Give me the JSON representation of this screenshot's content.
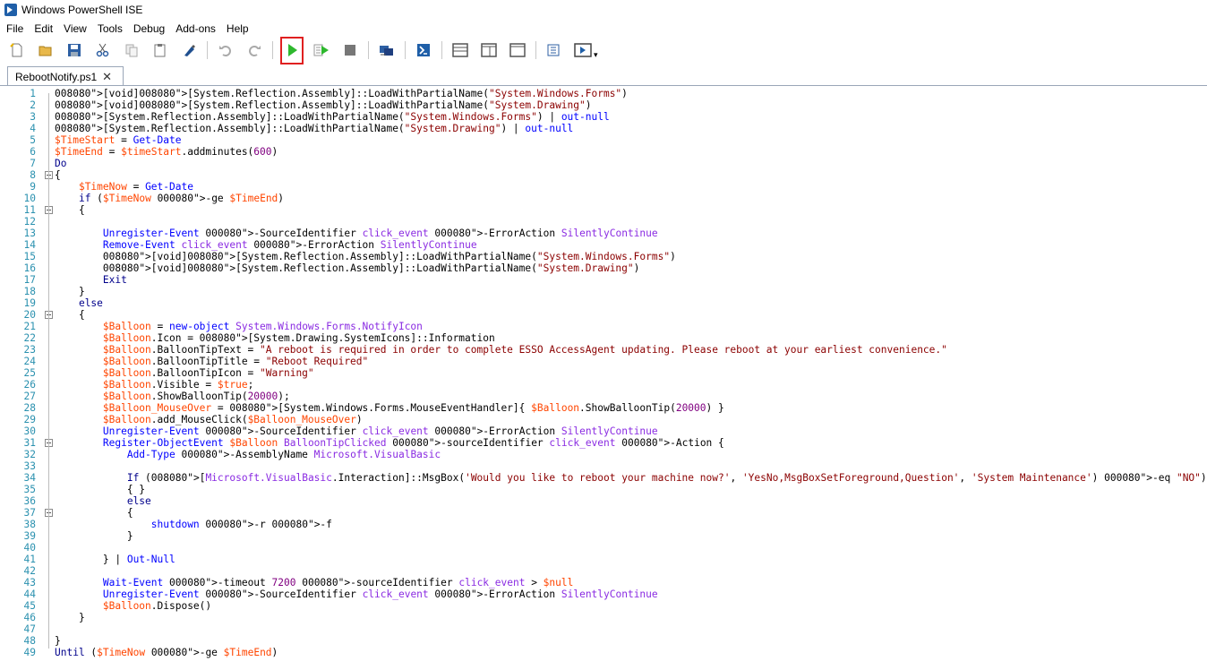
{
  "window": {
    "title": "Windows PowerShell ISE"
  },
  "menu": [
    "File",
    "Edit",
    "View",
    "Tools",
    "Debug",
    "Add-ons",
    "Help"
  ],
  "toolbar": {
    "icons": [
      "new-file-icon",
      "open-folder-icon",
      "save-icon",
      "cut-icon",
      "copy-icon",
      "paste-icon",
      "clear-console-icon",
      "undo-icon",
      "redo-icon",
      "run-script-icon",
      "run-selection-icon",
      "stop-icon",
      "remote-powershell-icon",
      "powershell-console-icon",
      "layout-top-icon",
      "layout-right-icon",
      "layout-max-icon",
      "show-commands-icon",
      "show-addon-icon",
      "toolbar-overflow-icon"
    ],
    "colors": {
      "run": "#2eb82e",
      "highlight": "#e02020"
    }
  },
  "tab": {
    "label": "RebootNotify.ps1",
    "close": "✕"
  },
  "editor": {
    "colors": {
      "line_numbers": "#2b91af"
    },
    "lines": [
      "[void][System.Reflection.Assembly]::LoadWithPartialName(\"System.Windows.Forms\")",
      "[void][System.Reflection.Assembly]::LoadWithPartialName(\"System.Drawing\")",
      "[System.Reflection.Assembly]::LoadWithPartialName(\"System.Windows.Forms\") | out-null",
      "[System.Reflection.Assembly]::LoadWithPartialName(\"System.Drawing\") | out-null",
      "$TimeStart = Get-Date",
      "$TimeEnd = $timeStart.addminutes(600)",
      "Do",
      "{",
      "    $TimeNow = Get-Date",
      "    if ($TimeNow -ge $TimeEnd)",
      "    {",
      "",
      "        Unregister-Event -SourceIdentifier click_event -ErrorAction SilentlyContinue",
      "        Remove-Event click_event -ErrorAction SilentlyContinue",
      "        [void][System.Reflection.Assembly]::LoadWithPartialName(\"System.Windows.Forms\")",
      "        [void][System.Reflection.Assembly]::LoadWithPartialName(\"System.Drawing\")",
      "        Exit",
      "    }",
      "    else",
      "    {",
      "        $Balloon = new-object System.Windows.Forms.NotifyIcon",
      "        $Balloon.Icon = [System.Drawing.SystemIcons]::Information",
      "        $Balloon.BalloonTipText = \"A reboot is required in order to complete ESSO AccessAgent updating. Please reboot at your earliest convenience.\"",
      "        $Balloon.BalloonTipTitle = \"Reboot Required\"",
      "        $Balloon.BalloonTipIcon = \"Warning\"",
      "        $Balloon.Visible = $true;",
      "        $Balloon.ShowBalloonTip(20000);",
      "        $Balloon_MouseOver = [System.Windows.Forms.MouseEventHandler]{ $Balloon.ShowBalloonTip(20000) }",
      "        $Balloon.add_MouseClick($Balloon_MouseOver)",
      "        Unregister-Event -SourceIdentifier click_event -ErrorAction SilentlyContinue",
      "        Register-ObjectEvent $Balloon BalloonTipClicked -sourceIdentifier click_event -Action {",
      "            Add-Type -AssemblyName Microsoft.VisualBasic",
      "",
      "            If ([Microsoft.VisualBasic.Interaction]::MsgBox('Would you like to reboot your machine now?', 'YesNo,MsgBoxSetForeground,Question', 'System Maintenance') -eq \"NO\")",
      "            { }",
      "            else",
      "            {",
      "                shutdown -r -f",
      "            }",
      "",
      "        } | Out-Null",
      "",
      "        Wait-Event -timeout 7200 -sourceIdentifier click_event > $null",
      "        Unregister-Event -SourceIdentifier click_event -ErrorAction SilentlyContinue",
      "        $Balloon.Dispose()",
      "    }",
      "",
      "}",
      "Until ($TimeNow -ge $TimeEnd)"
    ]
  }
}
